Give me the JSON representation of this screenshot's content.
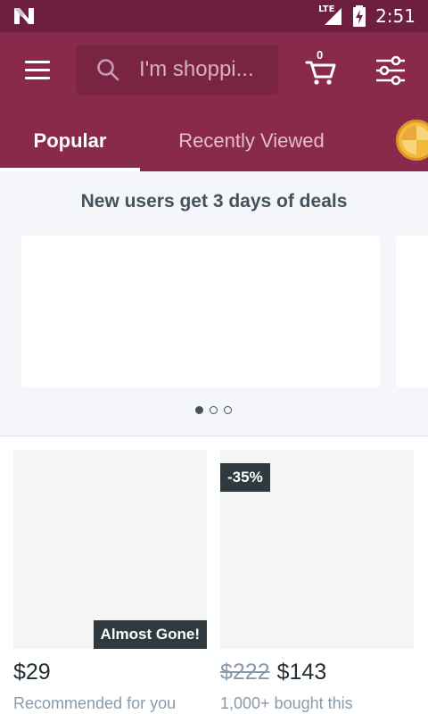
{
  "status_bar": {
    "network": "LTE",
    "time": "2:51"
  },
  "header": {
    "search_placeholder": "I'm shoppi...",
    "cart_count": "0",
    "tabs": [
      {
        "label": "Popular",
        "active": true
      },
      {
        "label": "Recently Viewed",
        "active": false
      }
    ]
  },
  "deals": {
    "title": "New users get 3 days of deals",
    "carousel_page": 1,
    "carousel_total": 3
  },
  "products": [
    {
      "badge": "Almost Gone!",
      "price": "$29",
      "original_price": "",
      "subtitle": "Recommended for you"
    },
    {
      "badge": "-35%",
      "price": "$143",
      "original_price": "$222",
      "subtitle": "1,000+ bought this"
    }
  ],
  "colors": {
    "status_bar": "#6e1e3e",
    "app_bar": "#892a4d",
    "deals_bg": "#f4f6f9",
    "badge_bg": "#2e3a3e"
  },
  "icons": [
    "n-logo-icon",
    "lte-signal-icon",
    "battery-charging-icon",
    "menu-icon",
    "search-icon",
    "cart-icon",
    "filter-icon",
    "coin-icon"
  ]
}
